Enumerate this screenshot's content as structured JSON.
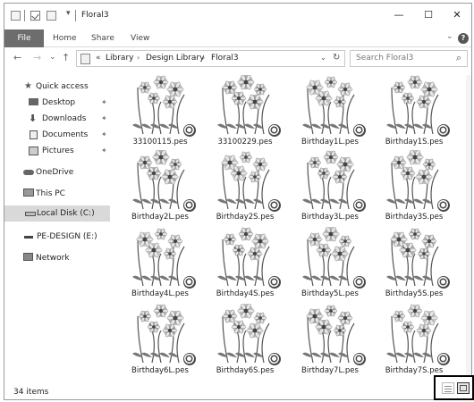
{
  "window": {
    "title": "Floral3",
    "controls": {
      "minimize": "—",
      "maximize": "☐",
      "close": "✕"
    }
  },
  "ribbon": {
    "file_tab": "File",
    "tabs": [
      "Home",
      "Share",
      "View"
    ],
    "expand": "⌄",
    "help": "?"
  },
  "address": {
    "prefix": "«",
    "crumbs": [
      "Library",
      "Design Library",
      "Floral3"
    ],
    "separator": "›",
    "dropdown": "⌄",
    "refresh": "↻"
  },
  "search": {
    "placeholder": "Search Floral3",
    "icon": "⌕"
  },
  "nav_buttons": {
    "back": "←",
    "forward": "→",
    "recent": "⌄",
    "up": "↑"
  },
  "sidebar": {
    "items": [
      {
        "label": "Quick access",
        "icon": "star-icon",
        "pinned": false
      },
      {
        "label": "Desktop",
        "icon": "desktop-icon",
        "pinned": true
      },
      {
        "label": "Downloads",
        "icon": "download-icon",
        "pinned": true
      },
      {
        "label": "Documents",
        "icon": "documents-icon",
        "pinned": true
      },
      {
        "label": "Pictures",
        "icon": "pictures-icon",
        "pinned": true
      },
      {
        "label": "OneDrive",
        "icon": "cloud-icon",
        "pinned": false
      },
      {
        "label": "This PC",
        "icon": "computer-icon",
        "pinned": false
      },
      {
        "label": "Local Disk (C:)",
        "icon": "drive-icon",
        "pinned": false,
        "selected": true
      },
      {
        "label": "PE-DESIGN (E:)",
        "icon": "usb-drive-icon",
        "pinned": false
      },
      {
        "label": "Network",
        "icon": "network-icon",
        "pinned": false
      }
    ],
    "pin_glyph": "📌"
  },
  "files": [
    {
      "name": "33100115.pes"
    },
    {
      "name": "33100229.pes"
    },
    {
      "name": "Birthday1L.pes"
    },
    {
      "name": "Birthday1S.pes"
    },
    {
      "name": "Birthday2L.pes"
    },
    {
      "name": "Birthday2S.pes"
    },
    {
      "name": "Birthday3L.pes"
    },
    {
      "name": "Birthday3S.pes"
    },
    {
      "name": "Birthday4L.pes"
    },
    {
      "name": "Birthday4S.pes"
    },
    {
      "name": "Birthday5L.pes"
    },
    {
      "name": "Birthday5S.pes"
    },
    {
      "name": "Birthday6L.pes"
    },
    {
      "name": "Birthday6S.pes"
    },
    {
      "name": "Birthday7L.pes"
    },
    {
      "name": "Birthday7S.pes"
    }
  ],
  "status": {
    "count": "34 items"
  },
  "colors": {
    "file_tab_bg": "#6d6d6d",
    "selected_nav_bg": "#d9d9d9",
    "badge": "#4a4a4a"
  }
}
